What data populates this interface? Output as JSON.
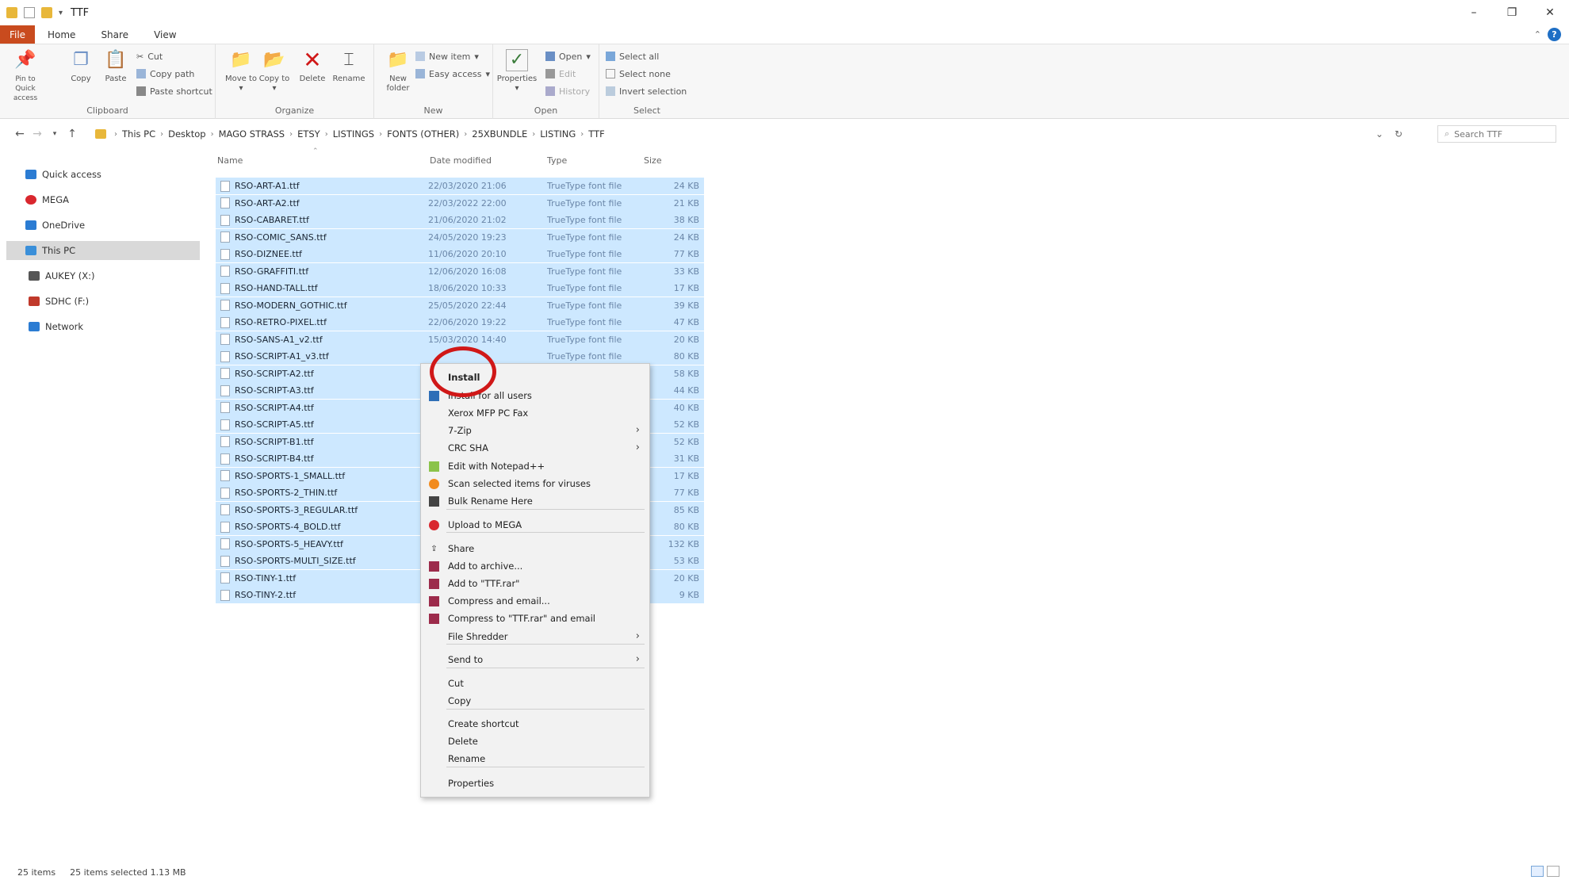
{
  "window": {
    "title": "TTF",
    "minimize": "–",
    "restore": "❐",
    "close": "✕"
  },
  "ribbon_tabs": [
    "File",
    "Home",
    "Share",
    "View"
  ],
  "ribbon": {
    "clipboard": {
      "label": "Clipboard",
      "pin": "Pin to Quick access",
      "copy": "Copy",
      "paste": "Paste",
      "cut": "Cut",
      "copy_path": "Copy path",
      "paste_shortcut": "Paste shortcut"
    },
    "organize": {
      "label": "Organize",
      "move_to": "Move to",
      "copy_to": "Copy to",
      "delete": "Delete",
      "rename": "Rename"
    },
    "new": {
      "label": "New",
      "new_folder": "New folder",
      "new_item": "New item",
      "easy_access": "Easy access"
    },
    "open": {
      "label": "Open",
      "properties": "Properties",
      "open": "Open",
      "edit": "Edit",
      "history": "History"
    },
    "select": {
      "label": "Select",
      "select_all": "Select all",
      "select_none": "Select none",
      "invert_selection": "Invert selection"
    }
  },
  "address": {
    "crumbs": [
      "This PC",
      "Desktop",
      "MAGO STRASS",
      "ETSY",
      "LISTINGS",
      "FONTS (OTHER)",
      "25XBUNDLE",
      "LISTING",
      "TTF"
    ],
    "search_placeholder": "Search TTF"
  },
  "nav_pane": [
    {
      "label": "Quick access",
      "icon": "star-icon",
      "color": "#2b7cd3"
    },
    {
      "label": "MEGA",
      "icon": "mega-icon",
      "color": "#d9272e"
    },
    {
      "label": "OneDrive",
      "icon": "cloud-icon",
      "color": "#2b7cd3"
    },
    {
      "label": "This PC",
      "icon": "computer-icon",
      "color": "#3a8fd9"
    },
    {
      "label": "AUKEY (X:)",
      "icon": "drive-icon",
      "color": "#555555"
    },
    {
      "label": "SDHC (F:)",
      "icon": "sd-card-icon",
      "color": "#c0392b"
    },
    {
      "label": "Network",
      "icon": "network-icon",
      "color": "#2b7cd3"
    }
  ],
  "columns": {
    "name": "Name",
    "date": "Date modified",
    "type": "Type",
    "size": "Size"
  },
  "files": [
    {
      "name": "RSO-ART-A1.ttf",
      "date": "22/03/2020 21:06",
      "type": "TrueType font file",
      "size": "24 KB"
    },
    {
      "name": "RSO-ART-A2.ttf",
      "date": "22/03/2022 22:00",
      "type": "TrueType font file",
      "size": "21 KB"
    },
    {
      "name": "RSO-CABARET.ttf",
      "date": "21/06/2020 21:02",
      "type": "TrueType font file",
      "size": "38 KB"
    },
    {
      "name": "RSO-COMIC_SANS.ttf",
      "date": "24/05/2020 19:23",
      "type": "TrueType font file",
      "size": "24 KB"
    },
    {
      "name": "RSO-DIZNEE.ttf",
      "date": "11/06/2020 20:10",
      "type": "TrueType font file",
      "size": "77 KB"
    },
    {
      "name": "RSO-GRAFFITI.ttf",
      "date": "12/06/2020 16:08",
      "type": "TrueType font file",
      "size": "33 KB"
    },
    {
      "name": "RSO-HAND-TALL.ttf",
      "date": "18/06/2020 10:33",
      "type": "TrueType font file",
      "size": "17 KB"
    },
    {
      "name": "RSO-MODERN_GOTHIC.ttf",
      "date": "25/05/2020 22:44",
      "type": "TrueType font file",
      "size": "39 KB"
    },
    {
      "name": "RSO-RETRO-PIXEL.ttf",
      "date": "22/06/2020 19:22",
      "type": "TrueType font file",
      "size": "47 KB"
    },
    {
      "name": "RSO-SANS-A1_v2.ttf",
      "date": "15/03/2020 14:40",
      "type": "TrueType font file",
      "size": "20 KB"
    },
    {
      "name": "RSO-SCRIPT-A1_v3.ttf",
      "date": "",
      "type": "TrueType font file",
      "size": "80 KB"
    },
    {
      "name": "RSO-SCRIPT-A2.ttf",
      "date": "",
      "type": "",
      "size": "58 KB"
    },
    {
      "name": "RSO-SCRIPT-A3.ttf",
      "date": "",
      "type": "",
      "size": "44 KB"
    },
    {
      "name": "RSO-SCRIPT-A4.ttf",
      "date": "",
      "type": "",
      "size": "40 KB"
    },
    {
      "name": "RSO-SCRIPT-A5.ttf",
      "date": "",
      "type": "",
      "size": "52 KB"
    },
    {
      "name": "RSO-SCRIPT-B1.ttf",
      "date": "",
      "type": "",
      "size": "52 KB"
    },
    {
      "name": "RSO-SCRIPT-B4.ttf",
      "date": "",
      "type": "",
      "size": "31 KB"
    },
    {
      "name": "RSO-SPORTS-1_SMALL.ttf",
      "date": "",
      "type": "",
      "size": "17 KB"
    },
    {
      "name": "RSO-SPORTS-2_THIN.ttf",
      "date": "",
      "type": "",
      "size": "77 KB"
    },
    {
      "name": "RSO-SPORTS-3_REGULAR.ttf",
      "date": "",
      "type": "",
      "size": "85 KB"
    },
    {
      "name": "RSO-SPORTS-4_BOLD.ttf",
      "date": "",
      "type": "",
      "size": "80 KB"
    },
    {
      "name": "RSO-SPORTS-5_HEAVY.ttf",
      "date": "",
      "type": "",
      "size": "132 KB"
    },
    {
      "name": "RSO-SPORTS-MULTI_SIZE.ttf",
      "date": "",
      "type": "",
      "size": "53 KB"
    },
    {
      "name": "RSO-TINY-1.ttf",
      "date": "",
      "type": "",
      "size": "20 KB"
    },
    {
      "name": "RSO-TINY-2.ttf",
      "date": "",
      "type": "",
      "size": "9 KB"
    }
  ],
  "context_menu": [
    {
      "label": "Install",
      "bold": true,
      "icon": "",
      "arrow": false
    },
    {
      "label": "Install for all users",
      "bold": false,
      "icon": "shield-icon",
      "arrow": false
    },
    {
      "label": "Xerox MFP PC Fax",
      "bold": false,
      "icon": "",
      "arrow": false
    },
    {
      "label": "7-Zip",
      "bold": false,
      "icon": "",
      "arrow": true
    },
    {
      "label": "CRC SHA",
      "bold": false,
      "icon": "",
      "arrow": true
    },
    {
      "label": "Edit with Notepad++",
      "bold": false,
      "icon": "notepad-icon",
      "arrow": false
    },
    {
      "label": "Scan selected items for viruses",
      "bold": false,
      "icon": "antivirus-icon",
      "arrow": false
    },
    {
      "label": "Bulk Rename Here",
      "bold": false,
      "icon": "rename-icon",
      "arrow": false
    },
    {
      "label": "Upload to MEGA",
      "bold": false,
      "icon": "mega-icon",
      "arrow": false
    },
    {
      "label": "Share",
      "bold": false,
      "icon": "share-icon",
      "arrow": false
    },
    {
      "label": "Add to archive...",
      "bold": false,
      "icon": "winrar-icon",
      "arrow": false
    },
    {
      "label": "Add to \"TTF.rar\"",
      "bold": false,
      "icon": "winrar-icon",
      "arrow": false
    },
    {
      "label": "Compress and email...",
      "bold": false,
      "icon": "winrar-icon",
      "arrow": false
    },
    {
      "label": "Compress to \"TTF.rar\" and email",
      "bold": false,
      "icon": "winrar-icon",
      "arrow": false
    },
    {
      "label": "File Shredder",
      "bold": false,
      "icon": "",
      "arrow": true
    },
    {
      "label": "Send to",
      "bold": false,
      "icon": "",
      "arrow": true
    },
    {
      "label": "Cut",
      "bold": false,
      "icon": "",
      "arrow": false
    },
    {
      "label": "Copy",
      "bold": false,
      "icon": "",
      "arrow": false
    },
    {
      "label": "Create shortcut",
      "bold": false,
      "icon": "",
      "arrow": false
    },
    {
      "label": "Delete",
      "bold": false,
      "icon": "",
      "arrow": false
    },
    {
      "label": "Rename",
      "bold": false,
      "icon": "",
      "arrow": false
    },
    {
      "label": "Properties",
      "bold": false,
      "icon": "",
      "arrow": false
    }
  ],
  "status": {
    "count": "25 items",
    "selected": "25 items selected  1.13 MB"
  },
  "colors": {
    "file_tab": "#c94b1e",
    "selection": "#cde8ff",
    "highlight_circle": "#d01818"
  }
}
